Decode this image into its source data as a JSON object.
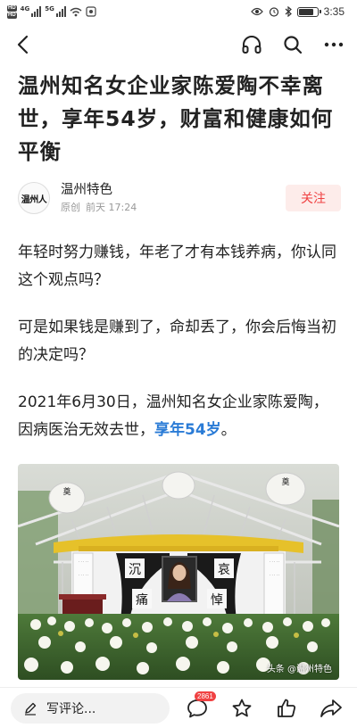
{
  "status_bar": {
    "hd_top": "HD",
    "hd_bottom": "HD",
    "network": "4G",
    "network2": "5G",
    "time": "3:35",
    "battery_level": 0.85
  },
  "nav": {
    "back_icon": "back-arrow-icon",
    "listen_icon": "headphones-icon",
    "search_icon": "search-icon",
    "more_icon": "more-dots-icon"
  },
  "article": {
    "title": "温州知名女企业家陈爱陶不幸离世，享年54岁，财富和健康如何平衡",
    "author": {
      "avatar_text": "温州人",
      "name": "温州特色",
      "tag": "原创",
      "time": "前天 17:24",
      "follow_label": "关注"
    },
    "paragraphs": {
      "p1": "年轻时努力赚钱，年老了才有本钱养病，你认同这个观点吗？",
      "p2": "可是如果钱是赚到了，命却丢了，你会后悔当初的决定吗？",
      "p3_text": "2021年6月30日，温州知名女企业家陈爱陶，因病医治无效去世，",
      "p3_highlight": "享年54岁",
      "p3_end": "。"
    },
    "photo": {
      "watermark": "头条 @温州特色",
      "banner_left_1": "沉",
      "banner_left_2": "痛",
      "banner_right_1": "哀",
      "banner_right_2": "悼",
      "lantern_text": "奠"
    }
  },
  "bottom_bar": {
    "comment_placeholder": "写评论...",
    "comment_count": "2861",
    "colors": {
      "accent": "#f04142",
      "highlight": "#2a7bd6"
    }
  }
}
